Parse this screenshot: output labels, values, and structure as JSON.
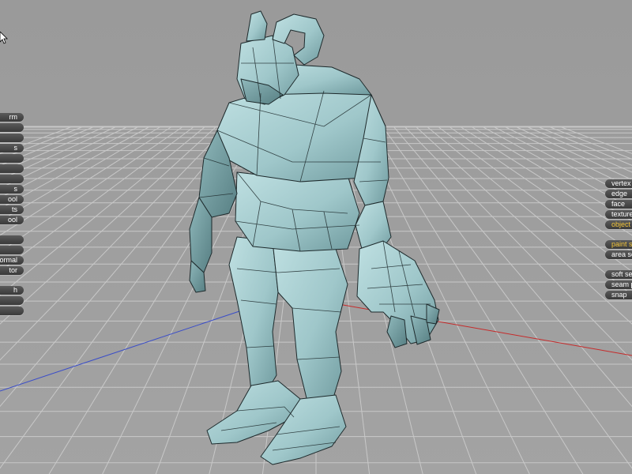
{
  "left_toolbar": {
    "groups": [
      {
        "items": [
          "rm",
          "",
          "",
          "s",
          "",
          "",
          "",
          "s",
          "ool",
          "ts",
          "ool"
        ]
      },
      {
        "items": [
          "",
          "",
          "ormal",
          "tor"
        ]
      },
      {
        "items": [
          "h",
          "",
          ""
        ]
      }
    ]
  },
  "right_toolbar": {
    "groups": [
      {
        "items": [
          {
            "label": "vertex",
            "active": false
          },
          {
            "label": "edge",
            "active": false
          },
          {
            "label": "face",
            "active": false
          },
          {
            "label": "texture",
            "active": false
          },
          {
            "label": "object",
            "active": true
          }
        ]
      },
      {
        "items": [
          {
            "label": "paint se",
            "active": true
          },
          {
            "label": "area se",
            "active": false
          }
        ]
      },
      {
        "items": [
          {
            "label": "soft se",
            "active": false
          },
          {
            "label": "seam p",
            "active": false
          },
          {
            "label": "snap",
            "active": false
          }
        ]
      }
    ]
  },
  "colors": {
    "background": "#9c9c9c",
    "grid_line": "#c8c8c8",
    "x_axis": "#c62a2a",
    "z_axis": "#3b4ec8",
    "mesh_fill": "#a9cfd2",
    "mesh_edge": "#1e2a2c",
    "button_bg": "#3f3f3f",
    "button_active_text": "#f3c53a"
  },
  "icons": {
    "cursor": "arrow-cursor-icon"
  }
}
